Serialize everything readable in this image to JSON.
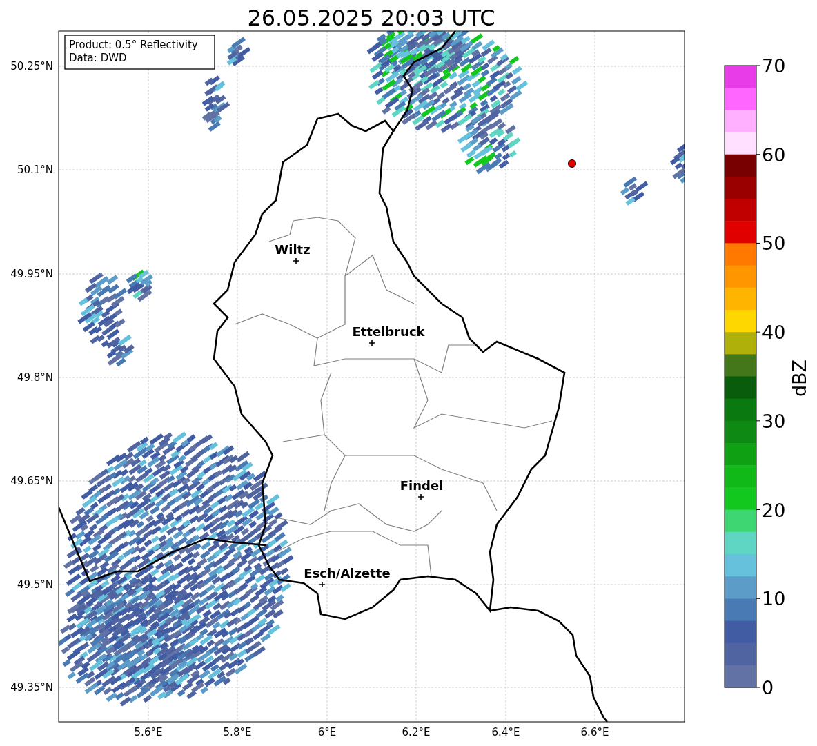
{
  "title": "26.05.2025 20:03 UTC",
  "info_box": [
    "Product: 0.5° Reflectivity",
    "Data: DWD"
  ],
  "latitude_labels": [
    "50.25°N",
    "50.1°N",
    "49.95°N",
    "49.8°N",
    "49.65°N",
    "49.5°N",
    "49.35°N"
  ],
  "longitude_labels": [
    "5.6°E",
    "5.8°E",
    "6°E",
    "6.2°E",
    "6.4°E",
    "6.6°E"
  ],
  "places": [
    {
      "name": "Wiltz"
    },
    {
      "name": "Ettelbruck"
    },
    {
      "name": "Findel"
    },
    {
      "name": "Esch/Alzette"
    }
  ],
  "colorbar": {
    "label": "dBZ",
    "ticks": [
      "70",
      "60",
      "50",
      "40",
      "30",
      "20",
      "10",
      "0"
    ],
    "colors": [
      {
        "color": "#e83ce8"
      },
      {
        "color": "#ff66ff"
      },
      {
        "color": "#ffb0ff"
      },
      {
        "color": "#ffe0ff"
      },
      {
        "color": "#780000"
      },
      {
        "color": "#9a0000"
      },
      {
        "color": "#c00000"
      },
      {
        "color": "#e00000"
      },
      {
        "color": "#ff7800"
      },
      {
        "color": "#ff9600"
      },
      {
        "color": "#ffb400"
      },
      {
        "color": "#ffd700"
      },
      {
        "color": "#b0b00a"
      },
      {
        "color": "#44761a"
      },
      {
        "color": "#085c0c"
      },
      {
        "color": "#0a7a10"
      },
      {
        "color": "#0e8a14"
      },
      {
        "color": "#0fa014"
      },
      {
        "color": "#10b818"
      },
      {
        "color": "#12c81e"
      },
      {
        "color": "#3dd672"
      },
      {
        "color": "#5fd6c4"
      },
      {
        "color": "#66c2dc"
      },
      {
        "color": "#5b9cc8"
      },
      {
        "color": "#4a7ab4"
      },
      {
        "color": "#425ca4"
      },
      {
        "color": "#4f64a0"
      },
      {
        "color": "#6272a4"
      }
    ]
  }
}
